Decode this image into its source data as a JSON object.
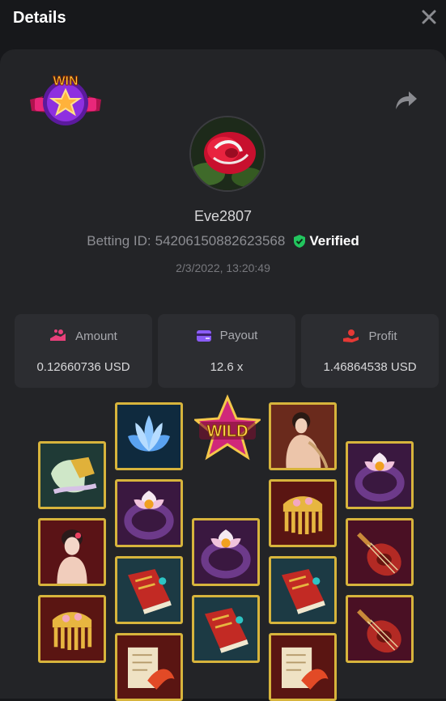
{
  "header": {
    "title": "Details"
  },
  "player": {
    "username": "Eve2807",
    "betting_id_label": "Betting ID:",
    "betting_id": "54206150882623568",
    "verified_label": "Verified",
    "timestamp": "2/3/2022, 13:20:49"
  },
  "badge": {
    "text": "WIN"
  },
  "stats": [
    {
      "label": "Amount",
      "value": "0.12660736 USD",
      "icon": "amount-icon",
      "color": "#e8407a"
    },
    {
      "label": "Payout",
      "value": "12.6 x",
      "icon": "wallet-icon",
      "color": "#8a5cf6"
    },
    {
      "label": "Profit",
      "value": "1.46864538 USD",
      "icon": "profit-hand-icon",
      "color": "#e53935"
    }
  ],
  "reels": {
    "wild_text": "WILD",
    "columns": [
      [
        "fan",
        "geisha-lady",
        "hair-comb"
      ],
      [
        "blue-lotus",
        "lotus-ring",
        "red-book",
        "koi-scroll"
      ],
      [
        "wild",
        "lotus-ring",
        "red-book"
      ],
      [
        "seated-lady",
        "hair-comb",
        "red-book",
        "koi-scroll"
      ],
      [
        "lotus-ring",
        "pipa-lute",
        "pipa-lute"
      ]
    ]
  },
  "colors": {
    "background": "#17181b",
    "card": "#232427",
    "stat_card": "#2c2d31",
    "tile_border": "#d7b43c",
    "verified": "#22c55e"
  }
}
